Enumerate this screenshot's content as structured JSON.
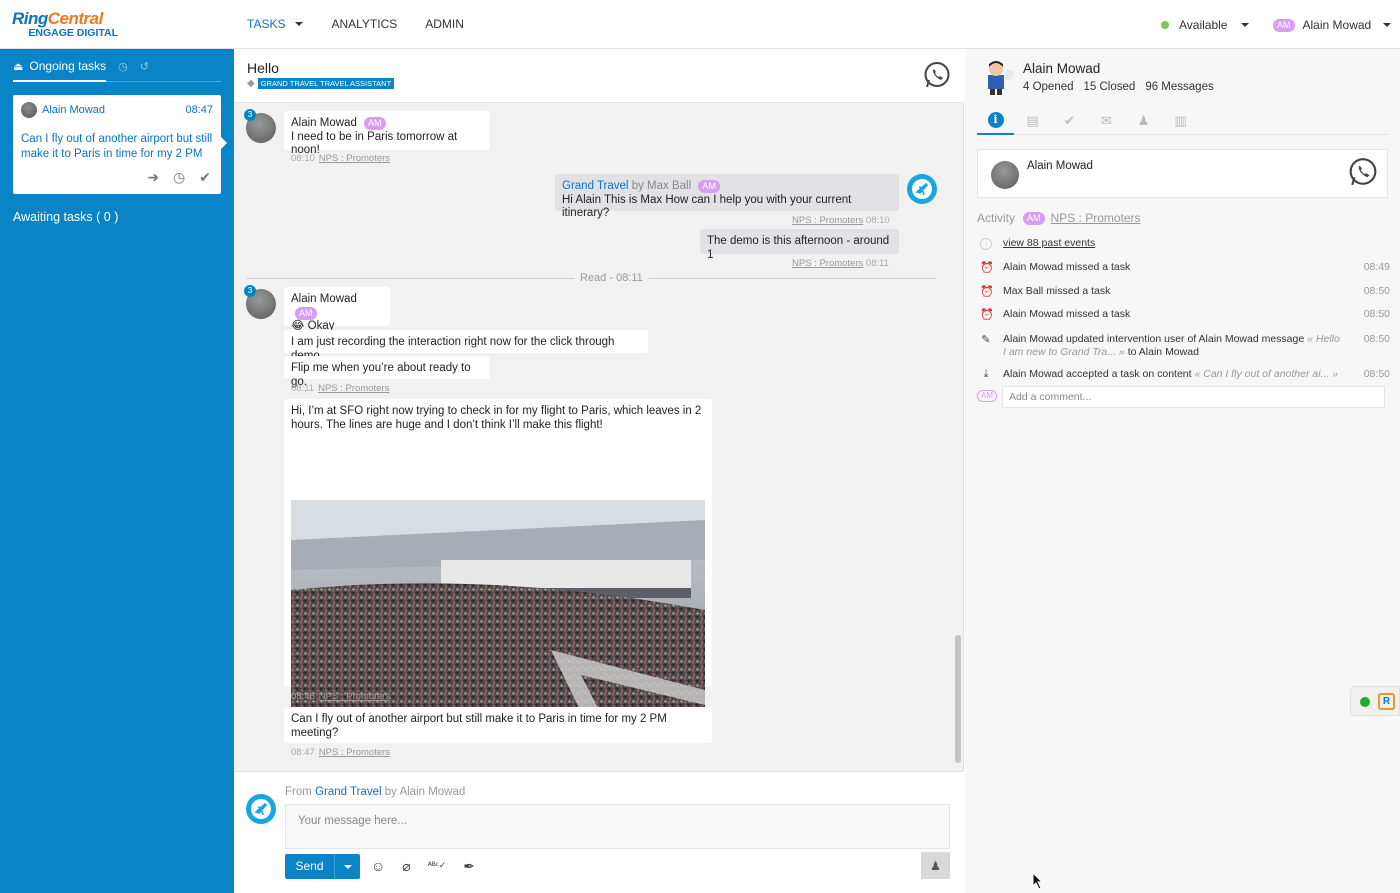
{
  "brand": {
    "name_part1": "Ring",
    "name_part2": "Central",
    "sub": "ENGAGE DIGITAL"
  },
  "nav": {
    "tasks": "TASKS",
    "analytics": "ANALYTICS",
    "admin": "ADMIN"
  },
  "status": {
    "label": "Available",
    "color": "#7dc657"
  },
  "current_user": {
    "initials": "AM",
    "name": "Alain Mowad"
  },
  "sidebar": {
    "ongoing_label": "Ongoing tasks",
    "task": {
      "name": "Alain Mowad",
      "time": "08:47",
      "message": "Can I fly out of another airport but still make it to Paris in time for my 2 PM"
    },
    "awaiting_label": "Awaiting tasks ( 0 )"
  },
  "conversation": {
    "title": "Hello",
    "tag": "GRAND TRAVEL TRAVEL ASSISTANT",
    "badge1": "3",
    "badge2": "3",
    "m1": {
      "name": "Alain Mowad",
      "initials": "AM",
      "text": "I need to be in Paris tomorrow at noon!",
      "time": "08:10",
      "cat": "NPS : Promoters"
    },
    "a1": {
      "source": "Grand Travel",
      "by": "by Max Ball",
      "initials": "AM",
      "text": "Hi Alain This is Max How can I help you with your current itinerary?",
      "cat": "NPS : Promoters",
      "time": "08:10"
    },
    "a2": {
      "text": "The demo is this afternoon - around 1",
      "cat": "NPS : Promoters",
      "time": "08:11"
    },
    "read": "Read - 08:11",
    "m2": {
      "name": "Alain Mowad",
      "initials": "AM",
      "emoji": "😂",
      "text": "Okay"
    },
    "m3": {
      "text": "I am just recording the interaction right now for the click through demo"
    },
    "m4": {
      "text": "Flip me when you’re about ready to go.",
      "time": "08:11",
      "cat": "NPS : Promoters"
    },
    "m5": {
      "text": "Hi, I’m at SFO right now trying to check in for my flight to Paris, which leaves in 2 hours. The lines are huge and I don’t think I’ll make this flight!",
      "time": "08:46",
      "cat": "NPS : Promoters"
    },
    "m6": {
      "text": "Can I fly out of another airport but still make it to Paris in time for my 2 PM meeting?",
      "time": "08:47",
      "cat": "NPS : Promoters"
    }
  },
  "composer": {
    "from_label": "From",
    "source": "Grand Travel",
    "by": "by Alain Mowad",
    "placeholder": "Your message here...",
    "send": "Send"
  },
  "profile": {
    "name": "Alain Mowad",
    "opened": "4 Opened",
    "closed": "15 Closed",
    "messages": "96 Messages",
    "card_name": "Alain Mowad",
    "activity_label": "Activity",
    "activity_initials": "AM",
    "activity_cat": "NPS : Promoters",
    "view_past": "view 88 past events",
    "events": [
      {
        "actor": "Alain Mowad",
        "text": "missed a task",
        "time": "08:49"
      },
      {
        "actor": "Max Ball",
        "text": "missed a task",
        "time": "08:50"
      },
      {
        "actor": "Alain Mowad",
        "text": "missed a task",
        "time": "08:50"
      },
      {
        "actor": "Alain Mowad",
        "text": "updated intervention user of Alain Mowad message",
        "quote": "« Hello I am new to Grand Tra... »",
        "tail": "to Alain Mowad",
        "time": "08:50"
      },
      {
        "actor": "Alain Mowad",
        "text": "accepted a task on content",
        "quote": "« Can I fly out of another ai... »",
        "time": "08:50"
      }
    ],
    "comment_initials": "AM",
    "comment_placeholder": "Add a comment..."
  }
}
